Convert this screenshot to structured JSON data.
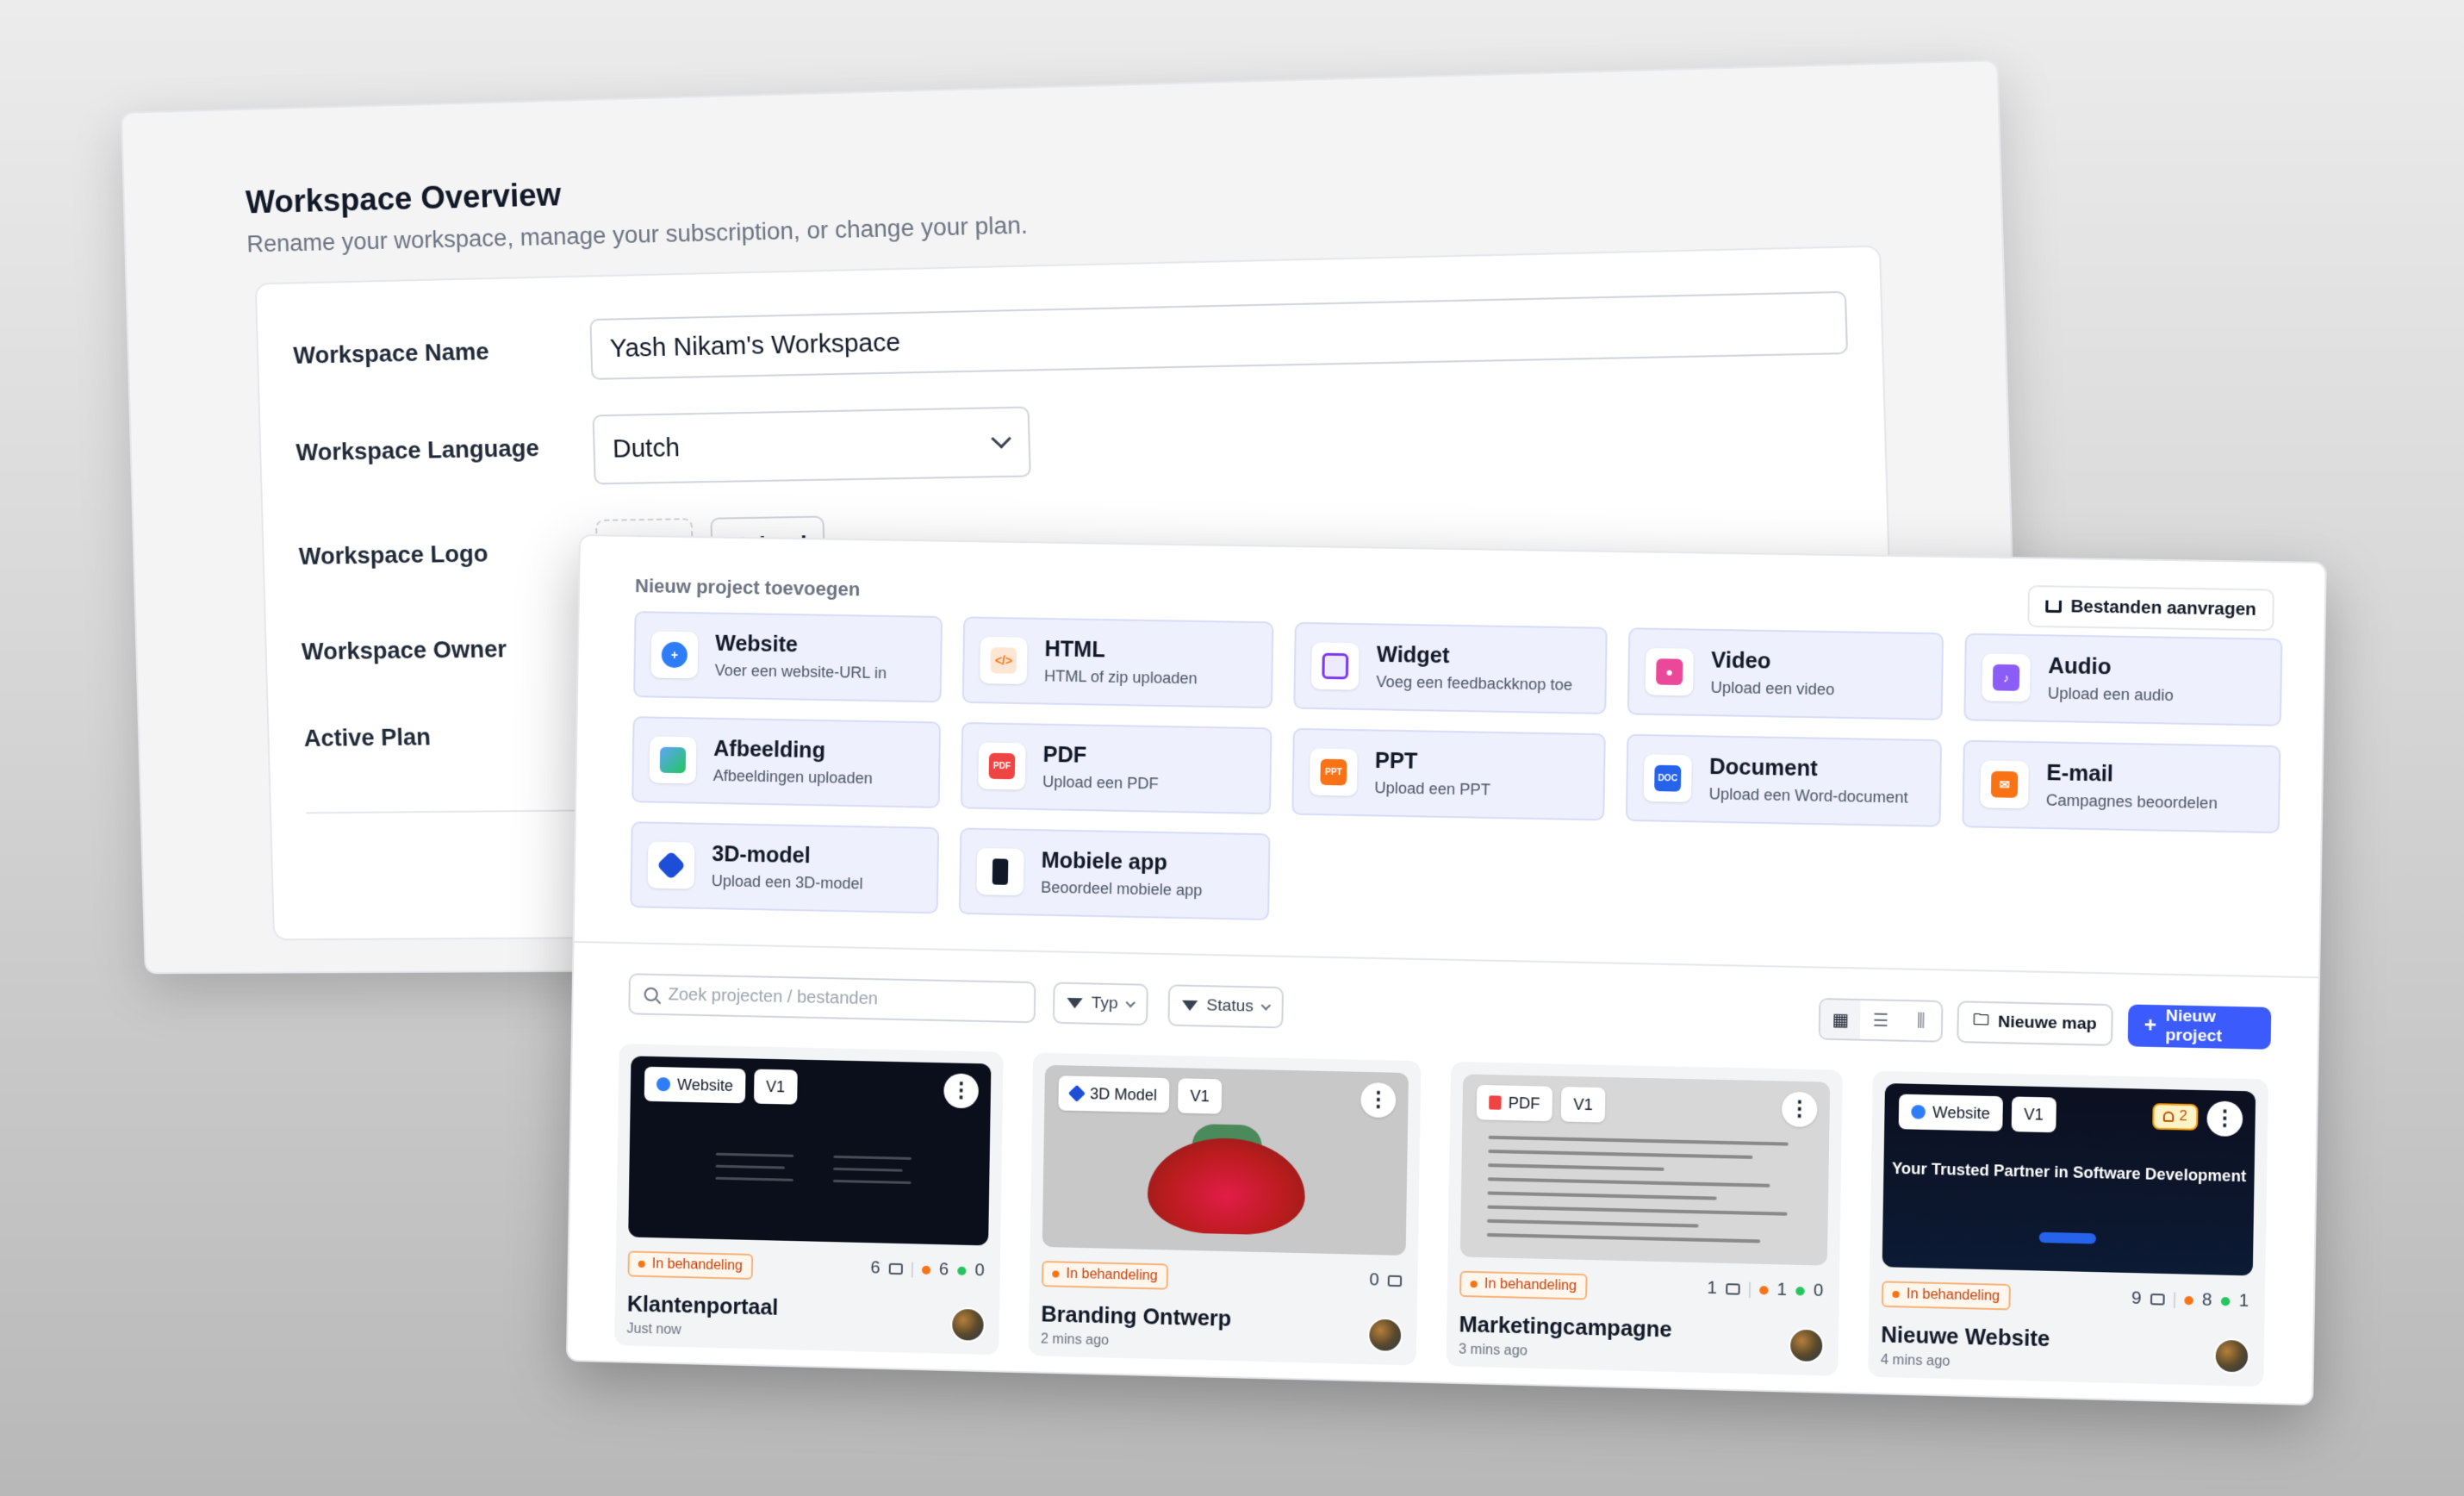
{
  "workspace": {
    "title": "Workspace Overview",
    "subtitle": "Rename your workspace, manage your subscription, or change your plan.",
    "labels": {
      "name": "Workspace Name",
      "language": "Workspace Language",
      "logo": "Workspace Logo",
      "owner": "Workspace Owner",
      "plan": "Active Plan"
    },
    "name_value": "Yash Nikam's Workspace",
    "language_value": "Dutch",
    "upload_label": "Upload"
  },
  "projects_panel": {
    "section_title": "Nieuw project toevoegen",
    "request_files_label": "Bestanden aanvragen",
    "types": [
      {
        "title": "Website",
        "desc": "Voer een website-URL in",
        "icon": "globe-icon",
        "color": "#2f7df6"
      },
      {
        "title": "HTML",
        "desc": "HTML of zip uploaden",
        "icon": "code-icon",
        "color": "#f97316"
      },
      {
        "title": "Widget",
        "desc": "Voeg een feedbackknop toe",
        "icon": "widget-icon",
        "color": "#7c3aed"
      },
      {
        "title": "Video",
        "desc": "Upload een video",
        "icon": "video-icon",
        "color": "#ec4899"
      },
      {
        "title": "Audio",
        "desc": "Upload een audio",
        "icon": "audio-icon",
        "color": "#8b5cf6"
      },
      {
        "title": "Afbeelding",
        "desc": "Afbeeldingen uploaden",
        "icon": "image-icon",
        "color": "#3b82f6"
      },
      {
        "title": "PDF",
        "desc": "Upload een PDF",
        "icon": "pdf-icon",
        "color": "#ef4444"
      },
      {
        "title": "PPT",
        "desc": "Upload een PPT",
        "icon": "ppt-icon",
        "color": "#f97316"
      },
      {
        "title": "Document",
        "desc": "Upload een Word-document",
        "icon": "document-icon",
        "color": "#2563eb"
      },
      {
        "title": "E-mail",
        "desc": "Campagnes beoordelen",
        "icon": "email-icon",
        "color": "#f97316"
      },
      {
        "title": "3D-model",
        "desc": "Upload een 3D-model",
        "icon": "cube-icon",
        "color": "#1d4ed8"
      },
      {
        "title": "Mobiele app",
        "desc": "Beoordeel mobiele app",
        "icon": "phone-icon",
        "color": "#111827"
      }
    ],
    "search_placeholder": "Zoek projecten / bestanden",
    "filter_type_label": "Typ",
    "filter_status_label": "Status",
    "new_folder_label": "Nieuwe map",
    "new_project_label": "Nieuw project",
    "accent_color": "#3b5bfd",
    "cards": [
      {
        "type_label": "Website",
        "version": "V1",
        "status": "In behandeling",
        "comments": "6",
        "open": "6",
        "resolved": "0",
        "title": "Klantenportaal",
        "time": "Just now"
      },
      {
        "type_label": "3D Model",
        "version": "V1",
        "status": "In behandeling",
        "comments": "0",
        "title": "Branding Ontwerp",
        "time": "2 mins ago"
      },
      {
        "type_label": "PDF",
        "version": "V1",
        "status": "In behandeling",
        "comments": "1",
        "open": "1",
        "resolved": "0",
        "title": "Marketingcampagne",
        "time": "3 mins ago"
      },
      {
        "type_label": "Website",
        "version": "V1",
        "status": "In behandeling",
        "comments": "9",
        "open": "8",
        "resolved": "1",
        "title": "Nieuwe Website",
        "time": "4 mins ago",
        "notifications": "2",
        "hero_text": "Your Trusted Partner in Software Development"
      }
    ]
  }
}
